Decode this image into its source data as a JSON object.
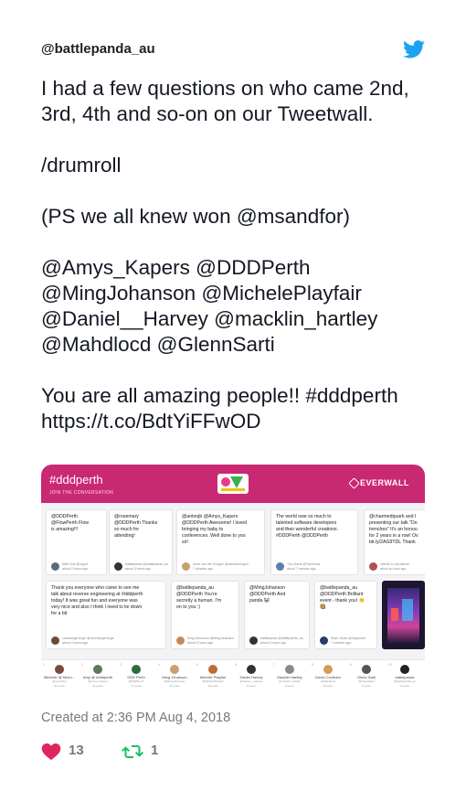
{
  "tweet": {
    "handle": "@battlepanda_au",
    "text": "I had a few questions on who came 2nd, 3rd, 4th and so-on on our Tweetwall.\n\n/drumroll\n\n(PS we all knew won @msandfor)\n\n@Amys_Kapers @DDDPerth @MingJohanson @MichelePlayfair @Daniel__Harvey @macklin_hartley @Mahdlocd @GlennSarti\n\nYou are all amazing people!! #dddperth https://t.co/BdtYiFFwOD",
    "created": "Created at 2:36 PM Aug 4, 2018",
    "likes": "13",
    "retweets": "1"
  },
  "icons": {
    "brand": "twitter-bird-icon",
    "like": "heart-icon",
    "retweet": "retweet-icon"
  },
  "colors": {
    "bird": "#1da1f2",
    "heart": "#e0245e",
    "retweet": "#17bf63",
    "wall": "#c92873"
  },
  "media": {
    "hashtag": "#dddperth",
    "join": "JOIN THE CONVERSATION",
    "brand": "EVERWALL",
    "posts_row1": [
      {
        "text": "@DDDPerth\n@FlowPerth Flow\nis amazing!!!",
        "meta": "Matt Gott @mgott\nabout 2 hours ago"
      },
      {
        "text": "@rosemary\n@DDDPerth Thanks\nso much for\nattending!",
        "meta": "battlepanda @battlepanda_au\nabout 3 hours ago"
      },
      {
        "text": "@antonjb @Amys_Kapers\n@DDDPerth Awesome! I loved\nbringing my baby to\nconferences. Well done to you\nsir!",
        "meta": "Anne van der Hoogen @vanderhoogen\n7 minutes ago"
      },
      {
        "text": "The world owe so much to\ntalented software developers\nand their wonderful creations.\n#DDDPerth @DDDPerth",
        "meta": "Tom Davis @TomDavis\nabout 7 minutes ago"
      },
      {
        "text": "@charmedquark and I\npresenting our talk \"Do\ntrenches\" It's an honou\nfor 2 years in a row! Ov\nbit.ly/2AG9TDL Thank",
        "meta": "Valerie Lu @valerieu\nabout an hour ago"
      }
    ],
    "posts_row2": [
      {
        "text": "Thank you everyone who came to see me\ntalk about reverse engineering at #dddperth\ntoday! It was great fun and everyone was\nvery nice and also I think I need to lie down\nfor a bit",
        "meta": "cavedangerdoge @cavedangerdoge\nabout 3 hours ago"
      },
      {
        "text": "@battlepanda_au\n@DDDPerth You're\nsecretly a human. I'm\non to you :)",
        "meta": "Ming Johanson @MingJohanson\nabout 3 hours ago"
      },
      {
        "text": "@MingJohanson\n@DDDPerth And\npanda 🐼",
        "meta": "battlepanda @battlepanda_au\nabout 3 hours ago"
      },
      {
        "text": "@battlepanda_au\n@DDDPerth Brilliant\nevent - thank you! 👏\n🥘",
        "meta": "Rhys Jones @rhysjones\n7 minutes ago"
      }
    ],
    "leaders": [
      {
        "rank": "1",
        "name": "Michelle @ Micro...",
        "handle": "@msandfor",
        "posts": "51 posts"
      },
      {
        "rank": "2",
        "name": "Amy @ #dddperth",
        "handle": "@Amys_Kapers",
        "posts": "21 posts"
      },
      {
        "rank": "3",
        "name": "DDD Perth",
        "handle": "@DDDPerth",
        "posts": "17 posts"
      },
      {
        "rank": "4",
        "name": "Ming Johanson",
        "handle": "@MingJohanson",
        "posts": "11 posts"
      },
      {
        "rank": "5",
        "name": "Michele Playfair",
        "handle": "@MichelePlayfair",
        "posts": "10 posts"
      },
      {
        "rank": "6",
        "name": "Daniel Harvey",
        "handle": "@Daniel__Harvey",
        "posts": "8 posts"
      },
      {
        "rank": "7",
        "name": "Macklin Hartley",
        "handle": "@macklin_hartley",
        "posts": "8 posts"
      },
      {
        "rank": "8",
        "name": "Denis Cordham",
        "handle": "@Mahdlocd",
        "posts": "8 posts"
      },
      {
        "rank": "9",
        "name": "Glenn Sarti",
        "handle": "@GlennSarti",
        "posts": "6 posts"
      },
      {
        "rank": "10",
        "name": "battlepanda",
        "handle": "@battlepanda_au",
        "posts": "6 posts"
      }
    ]
  }
}
